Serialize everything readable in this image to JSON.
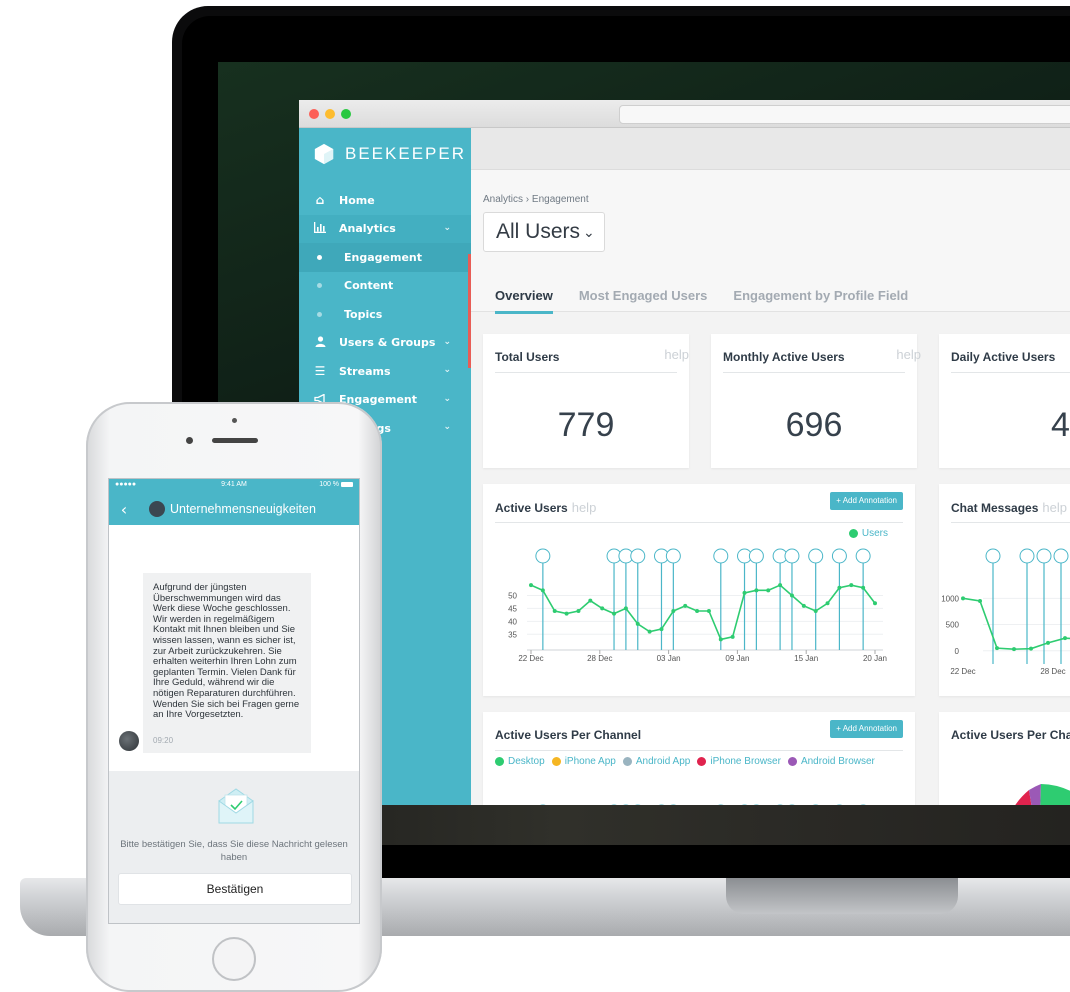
{
  "browser": {
    "sidebar": {
      "brand": "BEEKEEPER",
      "items": [
        {
          "label": "Home",
          "icon": "home-icon"
        },
        {
          "label": "Analytics",
          "icon": "bar-chart-icon"
        },
        {
          "label": "Engagement",
          "sub": true,
          "active": true
        },
        {
          "label": "Content",
          "sub": true
        },
        {
          "label": "Topics",
          "sub": true
        },
        {
          "label": "Users & Groups",
          "icon": "user-icon"
        },
        {
          "label": "Streams",
          "icon": "menu-icon"
        },
        {
          "label": "Engagement",
          "icon": "megaphone-icon"
        },
        {
          "label": "Settings",
          "icon": "gear-icon"
        }
      ]
    },
    "breadcrumb": "Analytics › Engagement",
    "user_select": "All Users",
    "tabs": [
      "Overview",
      "Most Engaged Users",
      "Engagement by Profile Field"
    ],
    "stats": [
      {
        "title": "Total Users",
        "help": "help",
        "value": "779"
      },
      {
        "title": "Monthly Active Users",
        "help": "help",
        "value": "696"
      },
      {
        "title": "Daily Active Users",
        "value": "452"
      }
    ],
    "active_users_card": {
      "title": "Active Users",
      "help": "help",
      "button": "+ Add Annotation",
      "legend": "Users"
    },
    "chat_messages_card": {
      "title": "Chat Messages",
      "help": "help"
    },
    "per_channel_card": {
      "title": "Active Users Per Channel",
      "button": "+ Add Annotation",
      "legend": [
        "Desktop",
        "iPhone App",
        "Android App",
        "iPhone Browser",
        "Android Browser"
      ]
    },
    "per_channel_card_2": {
      "title": "Active Users Per Chan"
    }
  },
  "colors": {
    "brand": "#4ab6c8",
    "line": "#2ecc71",
    "desktop": "#2ecc71",
    "iphone_app": "#f5b623",
    "android_app": "#9ab4c0",
    "iphone_browser": "#e0234e",
    "android_browser": "#9b59b6"
  },
  "chart_data": [
    {
      "type": "line",
      "title": "Active Users",
      "x_ticks": [
        "22 Dec",
        "28 Dec",
        "03 Jan",
        "09 Jan",
        "15 Jan",
        "20 Jan"
      ],
      "y_ticks": [
        35,
        40,
        45,
        50
      ],
      "ylim": [
        32,
        56
      ],
      "series": [
        {
          "name": "Users",
          "values": [
            54,
            52,
            44,
            43,
            44,
            48,
            45,
            43,
            45,
            39,
            36,
            37,
            44,
            46,
            44,
            44,
            33,
            34,
            51,
            52,
            52,
            54,
            50,
            46,
            44,
            47,
            53,
            54,
            53,
            47
          ]
        }
      ]
    },
    {
      "type": "line",
      "title": "Chat Messages",
      "x_ticks": [
        "22 Dec",
        "28 Dec"
      ],
      "y_ticks": [
        0,
        500,
        1000
      ],
      "ylim": [
        -100,
        1350
      ],
      "series": [
        {
          "values": [
            1000,
            950,
            50,
            30,
            40,
            150,
            240,
            220
          ]
        }
      ]
    },
    {
      "type": "line",
      "title": "Active Users Per Channel",
      "y_ticks": [
        40
      ],
      "series": [
        {
          "name": "Desktop"
        },
        {
          "name": "iPhone App"
        },
        {
          "name": "Android App"
        },
        {
          "name": "iPhone Browser"
        },
        {
          "name": "Android Browser"
        }
      ]
    }
  ],
  "phone": {
    "status_time": "9:41 AM",
    "status_carrier": "●●●●● ",
    "status_battery": "100 %",
    "channel": "Unternehmensneuigkeiten",
    "message": "Aufgrund der jüngsten Überschwemmungen wird das Werk diese Woche geschlossen. Wir werden in regelmäßigem Kontakt mit Ihnen bleiben und Sie wissen lassen, wann es sicher ist, zur Arbeit zurückzukehren. Sie erhalten weiterhin Ihren Lohn zum geplanten Termin. Vielen Dank für Ihre Geduld, während wir die nötigen Reparaturen durchführen. Wenden Sie sich bei Fragen gerne an Ihre Vorgesetzten.",
    "message_time": "09:20",
    "confirm_text": "Bitte bestätigen Sie, dass Sie diese Nachricht gelesen haben",
    "confirm_button": "Bestätigen"
  }
}
